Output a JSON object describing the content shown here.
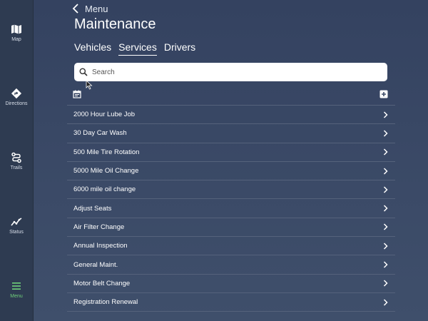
{
  "sidebar": {
    "items": [
      {
        "label": "Map",
        "icon": "map-icon"
      },
      {
        "label": "Directions",
        "icon": "directions-icon"
      },
      {
        "label": "Trails",
        "icon": "trails-icon"
      },
      {
        "label": "Status",
        "icon": "status-icon"
      },
      {
        "label": "Menu",
        "icon": "menu-icon",
        "active": true
      }
    ]
  },
  "header": {
    "back_label": "Menu",
    "title": "Maintenance"
  },
  "tabs": [
    {
      "label": "Vehicles"
    },
    {
      "label": "Services",
      "active": true
    },
    {
      "label": "Drivers"
    }
  ],
  "search": {
    "placeholder": "Search",
    "value": ""
  },
  "toolbar": {
    "left_icon": "calendar-icon",
    "right_icon": "add-icon"
  },
  "services": [
    {
      "label": "2000 Hour Lube Job"
    },
    {
      "label": "30 Day Car Wash"
    },
    {
      "label": "500 Mile Tire Rotation"
    },
    {
      "label": "5000 Mile Oil Change"
    },
    {
      "label": "6000 mile oil change"
    },
    {
      "label": "Adjust Seats"
    },
    {
      "label": "Air Filter Change"
    },
    {
      "label": "Annual Inspection"
    },
    {
      "label": "General Maint."
    },
    {
      "label": "Motor Belt Change"
    },
    {
      "label": "Registration Renewal"
    }
  ],
  "colors": {
    "active_nav": "#6fd07a",
    "background": "#3b4a66",
    "sidebar": "#2e3b51"
  }
}
